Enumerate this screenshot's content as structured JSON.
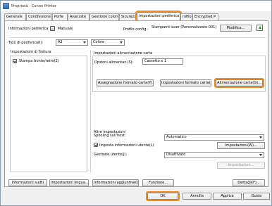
{
  "window": {
    "title": "Proprietà - Canon Printer"
  },
  "tabs": [
    {
      "label": "Generale"
    },
    {
      "label": "Condivisione"
    },
    {
      "label": "Porte"
    },
    {
      "label": "Avanzate"
    },
    {
      "label": "Gestione colori"
    },
    {
      "label": "Sicurezz"
    },
    {
      "label": "Impostazioni periferica"
    },
    {
      "label": "rofilo"
    },
    {
      "label": "Encrypted P"
    }
  ],
  "header": {
    "device_info_label": "Informazioni periferica:",
    "mode_value": "Manuale",
    "profile_label": "Profilo config.:",
    "profile_value": "Stampanti laser (Personalizzato 001)",
    "modify_button": "Modifica..."
  },
  "device_type": {
    "label": "Tipo di periferica(I):",
    "size_value": "A3",
    "color_value": "Colore"
  },
  "finishing": {
    "title": "Impostazioni di finitura",
    "duplex_label": "Stampa fronte/retro(2)",
    "duplex_checked": true
  },
  "paper_feed": {
    "title": "Impostazioni alimentazione carta",
    "options_label": "Opzioni alimentaz.(S):",
    "options_value": "Cassetto x 1",
    "assign_button": "Assegnazione formato carta(Y)...",
    "settings_button": "Impostazioni formato carta(X)...",
    "feed_button": "Alimentazione carta(G)..."
  },
  "other": {
    "title": "Altre impostazioni",
    "spooling_label": "Spooling sull'host:",
    "spooling_value": "Automatico",
    "user_info_label": "Imposta informazioni utente(L)",
    "user_info_checked": true,
    "settings_w_button": "Impostazioni(W)...",
    "user_mgmt_label": "Gestione utente(J):",
    "user_mgmt_value": "Disattivato",
    "settings_disabled_button": "Impostazioni..."
  },
  "bottom_buttons": {
    "info_button": "Informazioni su(B)",
    "language_button": "Impostazioni lingua...",
    "additional_button": "Informazioni aggiuntive(D)",
    "function_button": "Funzione...",
    "details_button": "Dettagli(F)..."
  },
  "dialog_buttons": {
    "ok": "OK",
    "cancel": "Annulla",
    "apply": "Applica",
    "help": "Guida"
  },
  "colors": {
    "highlight": "#f08c1e"
  }
}
